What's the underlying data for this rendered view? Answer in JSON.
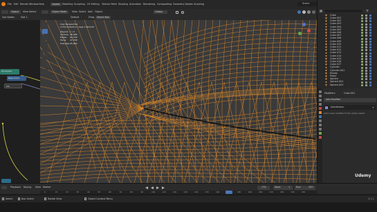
{
  "app": {
    "file_menu": [
      "File",
      "Edit",
      "Render",
      "Window",
      "Help"
    ],
    "workspace_tabs": [
      "Layout",
      "Modeling",
      "Sculpting",
      "UV Editing",
      "Texture Paint",
      "Shading",
      "Animation",
      "Rendering",
      "Compositing",
      "Geometry Nodes",
      "Scripting"
    ],
    "active_workspace": "Layout",
    "scene_name": "Scene",
    "view_layer": "ViewLayer"
  },
  "viewport_header": {
    "mode": "Object Mode",
    "menus": [
      "View",
      "Select",
      "Add",
      "Object"
    ],
    "transform_orientation": "Global",
    "snap_label": "Default",
    "drag_label": "Drag",
    "select_box": "Select Box"
  },
  "node_editor": {
    "mode": "Object",
    "menus": [
      "View",
      "Select",
      "Add",
      "Node"
    ],
    "use_nodes": "Use Nodes",
    "slot": "Slot 1",
    "node1": "Principled",
    "node2": "Base Color",
    "node3": "Mix"
  },
  "overlay_stats": {
    "view_name": "User Perspective",
    "collection": "(175) Collection | Legs 1.001A1P",
    "rows": [
      {
        "label": "Objects",
        "value": "1 / 9"
      },
      {
        "label": "Vertices",
        "value": "46,088"
      },
      {
        "label": "Edges",
        "value": "92,748"
      },
      {
        "label": "Faces",
        "value": "47,748"
      },
      {
        "label": "Triangles",
        "value": "95,484"
      }
    ]
  },
  "outliner": {
    "items": [
      "Cube",
      "Cube.001",
      "Cube.002",
      "Cube.003",
      "Cube.004",
      "Cube.005",
      "Cube.006",
      "Cube.007",
      "Cube.008",
      "Cube.009",
      "Cube.010",
      "Cube.011",
      "Cube.012",
      "Cube.013",
      "Cube.014",
      "Cube.015",
      "Cube.016",
      "Cube.017",
      "Cylinder",
      "Cylinder.001",
      "Empty",
      "Plane",
      "Sphere",
      "Sphere.001",
      "Sphere.002"
    ]
  },
  "properties": {
    "modifier_tab": "Modifiers",
    "object_tab": "Cube.001",
    "add_modifier": "Add Modifier",
    "modifier_name": "Subdivision",
    "hint": "Add a new modifier to the active object"
  },
  "timeline": {
    "menus": [
      "Playback",
      "Keying",
      "View",
      "Marker"
    ],
    "current_frame": "174",
    "start_label": "Start",
    "start": "1",
    "end_label": "End",
    "end": "250",
    "ticks": [
      "0",
      "10",
      "20",
      "30",
      "40",
      "50",
      "60",
      "70",
      "80",
      "90",
      "100",
      "110",
      "120",
      "130",
      "140",
      "150",
      "160",
      "170",
      "180",
      "190",
      "200",
      "210",
      "220",
      "230",
      "240"
    ]
  },
  "statusbar": {
    "select": "Select",
    "box_select": "Box Select",
    "rotate_view": "Rotate View",
    "context_menu": "Object Context Menu",
    "version": "3.1.2"
  },
  "branding": {
    "watermark": "Udemy"
  },
  "colors": {
    "wire": "#e08a2a",
    "viewport_bg": "#3a3a3a",
    "accent": "#4772b3",
    "node_teal": "#2e7a6a"
  }
}
